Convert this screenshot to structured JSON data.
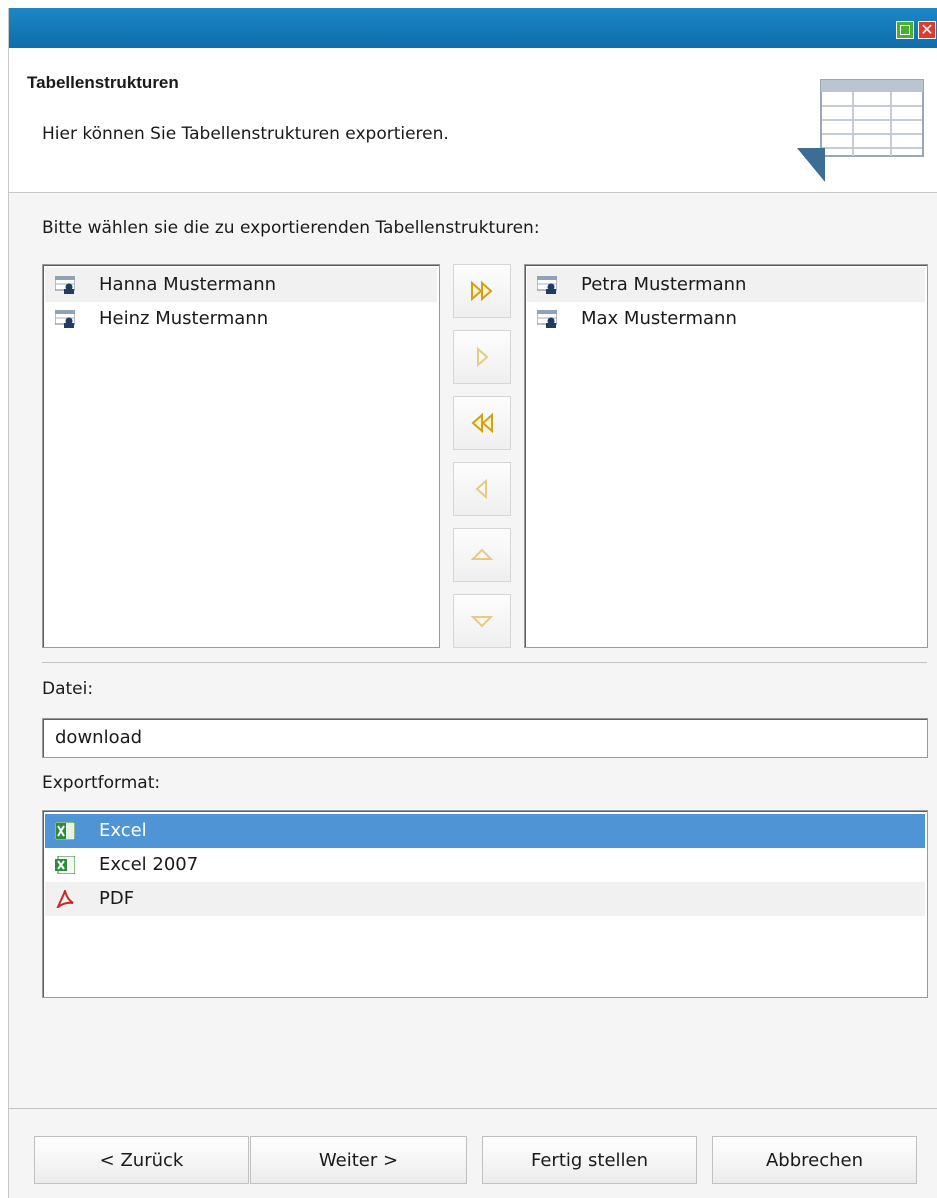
{
  "window": {
    "maximize_icon": "maximize-icon",
    "close_icon": "close-icon",
    "close_glyph": "✕",
    "titlebar_color": "#0e74b4"
  },
  "header": {
    "title": "Tabellenstrukturen",
    "subtitle": "Hier können Sie Tabellenstrukturen exportieren.",
    "icon": "table-structure-icon"
  },
  "selection": {
    "prompt": "Bitte wählen sie die zu exportierenden Tabellenstrukturen:",
    "available": [
      {
        "label": "Hanna Mustermann",
        "icon": "table-user-icon"
      },
      {
        "label": "Heinz Mustermann",
        "icon": "table-user-icon"
      }
    ],
    "selected": [
      {
        "label": "Petra Mustermann",
        "icon": "table-user-icon"
      },
      {
        "label": "Max Mustermann",
        "icon": "table-user-icon"
      }
    ],
    "transfer_buttons": [
      {
        "name": "move-all-right-button",
        "icon": "double-arrow-right-icon",
        "enabled": true
      },
      {
        "name": "move-right-button",
        "icon": "arrow-right-icon",
        "enabled": false
      },
      {
        "name": "move-all-left-button",
        "icon": "double-arrow-left-icon",
        "enabled": true
      },
      {
        "name": "move-left-button",
        "icon": "arrow-left-icon",
        "enabled": false
      },
      {
        "name": "move-up-button",
        "icon": "arrow-up-icon",
        "enabled": false
      },
      {
        "name": "move-down-button",
        "icon": "arrow-down-icon",
        "enabled": false
      }
    ]
  },
  "file": {
    "label": "Datei:",
    "value": "download"
  },
  "export_format": {
    "label": "Exportformat:",
    "options": [
      {
        "label": "Excel",
        "icon": "excel-icon",
        "selected": true
      },
      {
        "label": "Excel 2007",
        "icon": "excel-2007-icon",
        "selected": false
      },
      {
        "label": "PDF",
        "icon": "pdf-icon",
        "selected": false
      }
    ]
  },
  "footer": {
    "back": "< Zurück",
    "next": "Weiter >",
    "finish": "Fertig stellen",
    "cancel": "Abbrechen"
  },
  "colors": {
    "selection": "#4f94d4",
    "arrow_enabled": "#d4a017",
    "arrow_disabled": "#e8c98a"
  }
}
